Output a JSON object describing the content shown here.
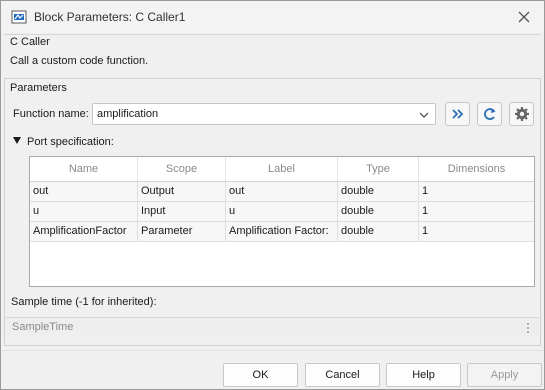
{
  "window": {
    "title": "Block Parameters: C Caller1"
  },
  "block": {
    "name": "C Caller",
    "description": "Call a custom code function."
  },
  "parameters": {
    "section_label": "Parameters",
    "function_name_label": "Function name:",
    "function_name_value": "amplification"
  },
  "port_spec": {
    "label": "Port specification:",
    "columns": [
      "Name",
      "Scope",
      "Label",
      "Type",
      "Dimensions"
    ],
    "rows": [
      [
        "out",
        "Output",
        "out",
        "double",
        "1"
      ],
      [
        "u",
        "Input",
        "u",
        "double",
        "1"
      ],
      [
        "AmplificationFactor",
        "Parameter",
        "Amplification Factor:",
        "double",
        "1"
      ]
    ]
  },
  "sample_time": {
    "label": "Sample time (-1 for inherited):",
    "placeholder": "SampleTime"
  },
  "buttons": {
    "ok": "OK",
    "cancel": "Cancel",
    "help": "Help",
    "apply": "Apply"
  },
  "icons": {
    "app": "simulink-block-icon",
    "close": "close-icon",
    "chevron": "chevron-down-icon",
    "forward": "double-chevron-right-icon",
    "refresh": "refresh-icon",
    "settings": "gear-icon"
  },
  "colors": {
    "accent": "#2a6fb8"
  }
}
